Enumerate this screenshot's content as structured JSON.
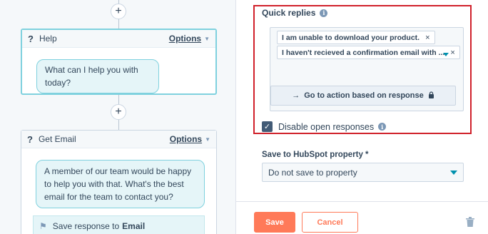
{
  "canvas": {
    "cards": [
      {
        "icon": "?",
        "title": "Help",
        "options_label": "Options",
        "message": "What can I help you with today?"
      },
      {
        "icon": "?",
        "title": "Get Email",
        "options_label": "Options",
        "message": "A member of our team would be happy to help you with that. What's the best email for the team to contact you?",
        "save_response_prefix": "Save response to",
        "save_response_property": "Email"
      }
    ],
    "plus_symbol": "+"
  },
  "panel": {
    "quick_replies_label": "Quick replies",
    "quick_replies": [
      {
        "label": "I am unable to download your product."
      },
      {
        "label": "I haven't recieved a confirmation email with ..."
      }
    ],
    "remove_symbol": "×",
    "goto_action_label": "Go to action based on response",
    "disable_open_responses_label": "Disable open responses",
    "disable_open_responses_checked": true,
    "save_property_label": "Save to HubSpot property *",
    "save_property_value": "Do not save to property"
  },
  "footer": {
    "save_label": "Save",
    "cancel_label": "Cancel"
  },
  "colors": {
    "accent_orange": "#ff7a59",
    "teal": "#7fd1de",
    "highlight_red": "#d0212b",
    "text_dark": "#33475b",
    "link_blue": "#0091ae"
  }
}
